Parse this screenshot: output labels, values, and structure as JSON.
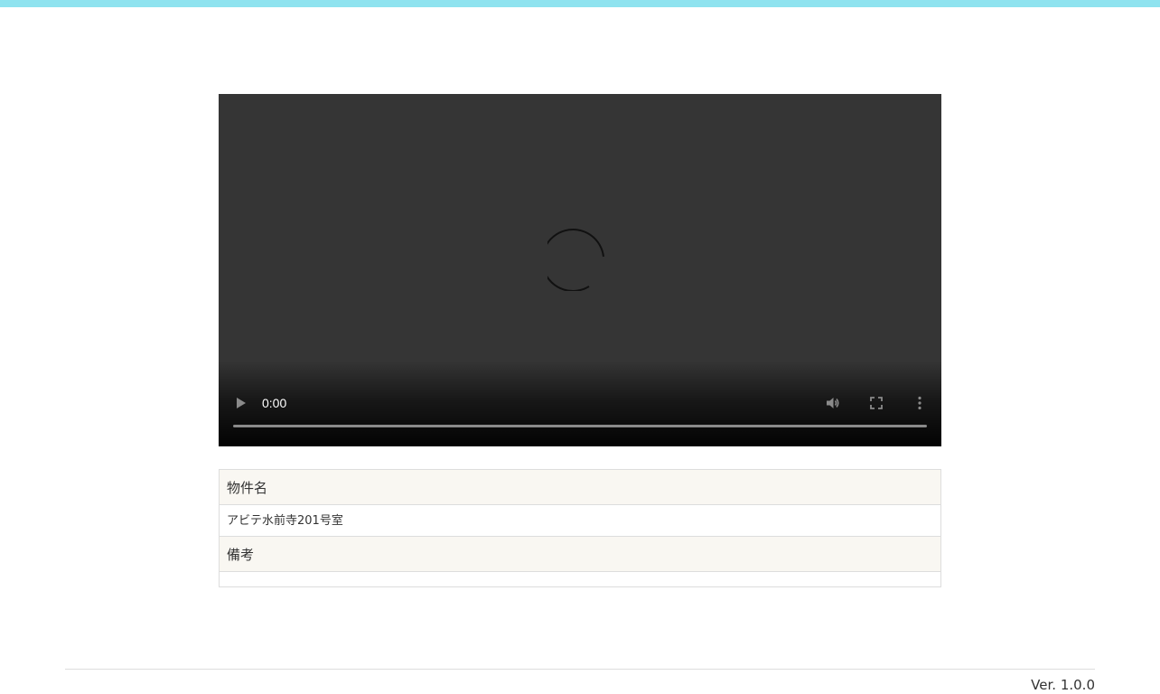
{
  "video": {
    "current_time": "0:00",
    "progress": 0,
    "state": "loading",
    "icons": {
      "play": "play-icon",
      "mute": "volume-icon",
      "fullscreen": "fullscreen-icon",
      "more": "more-vertical-icon",
      "loading": "loading-spinner-icon"
    }
  },
  "property": {
    "name_label": "物件名",
    "name_value": "アビテ水前寺201号室",
    "notes_label": "備考",
    "notes_value": ""
  },
  "footer": {
    "version": "Ver. 1.0.0"
  },
  "colors": {
    "top_bar": "#8fe3ef",
    "video_bg": "#353535",
    "header_row_bg": "#f9f7f2",
    "border": "#dddddd"
  }
}
